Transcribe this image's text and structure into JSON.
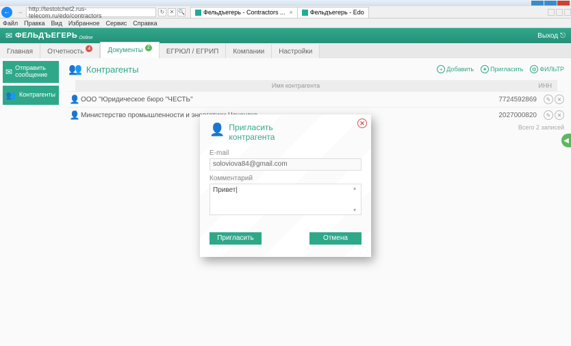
{
  "window": {
    "url": "http://testotchet2.rus-telecom.ru/edo/contractors",
    "tabs": [
      {
        "title": "Фельдъегерь - Contractors ..."
      },
      {
        "title": "Фельдъегерь - Edo"
      }
    ],
    "menu": [
      "Файл",
      "Правка",
      "Вид",
      "Избранное",
      "Сервис",
      "Справка"
    ]
  },
  "app": {
    "logo": "ФЕЛЬДЪЕГЕРЬ",
    "logo_sub": "Online",
    "exit": "Выход"
  },
  "nav": {
    "items": [
      {
        "label": "Главная",
        "badge": null
      },
      {
        "label": "Отчетность",
        "badge": "4",
        "badge_cls": "badge-red"
      },
      {
        "label": "Документы",
        "badge": "2",
        "badge_cls": "badge-green",
        "active": true
      },
      {
        "label": "ЕГРЮЛ / ЕГРИП"
      },
      {
        "label": "Компании"
      },
      {
        "label": "Настройки"
      }
    ]
  },
  "sidebar": {
    "send_label": "Отправить сообщение",
    "contr_label": "Контрагенты"
  },
  "page": {
    "title": "Контрагенты",
    "actions": {
      "add": "Добавить",
      "invite": "Пригласить",
      "filter": "ФИЛЬТР"
    },
    "columns": {
      "name": "Имя контрагента",
      "inn": "ИНН"
    },
    "rows": [
      {
        "name": "ООО \"Юридическое бюро \"ЧЕСТЬ\"",
        "inn": "7724592869"
      },
      {
        "name": "Министерство промышленности и энергетики Чеченско",
        "inn": "2027000820"
      }
    ],
    "total": "Всего 2 записей"
  },
  "modal": {
    "title_l1": "Пригласить",
    "title_l2": "контрагента",
    "email_label": "E-mail",
    "email_value": "soloviova84@gmail.com",
    "comment_label": "Комментарий",
    "comment_value": "Привет|",
    "ok": "Пригласить",
    "cancel": "Отмена"
  }
}
